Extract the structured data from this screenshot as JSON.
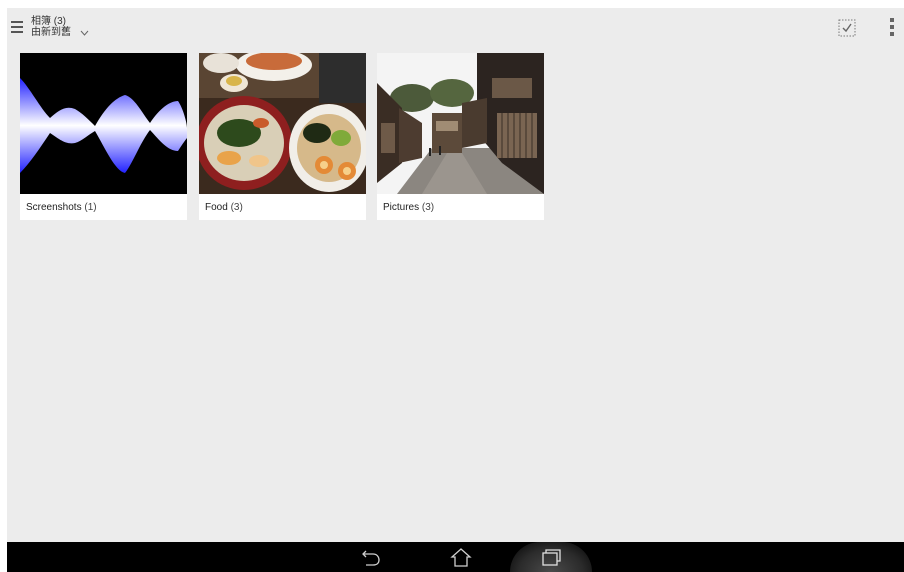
{
  "header": {
    "title": "相簿 (3)",
    "sort_label": "由新到舊",
    "icons": {
      "menu": "hamburger-menu-icon",
      "sort": "chevron-down-icon",
      "select": "select-all-icon",
      "overflow": "overflow-menu-icon"
    }
  },
  "albums": [
    {
      "name": "Screenshots",
      "count": "(1)",
      "thumbnail": "waveform-screenshot"
    },
    {
      "name": "Food",
      "count": "(3)",
      "thumbnail": "ramen-and-rice-bowl-photo"
    },
    {
      "name": "Pictures",
      "count": "(3)",
      "thumbnail": "old-street-photo"
    }
  ],
  "navbar": {
    "icons": [
      "back-icon",
      "home-icon",
      "recent-apps-icon"
    ]
  },
  "colors": {
    "background": "#ececec",
    "navbar": "#000000",
    "wave": "#3a3aff"
  }
}
